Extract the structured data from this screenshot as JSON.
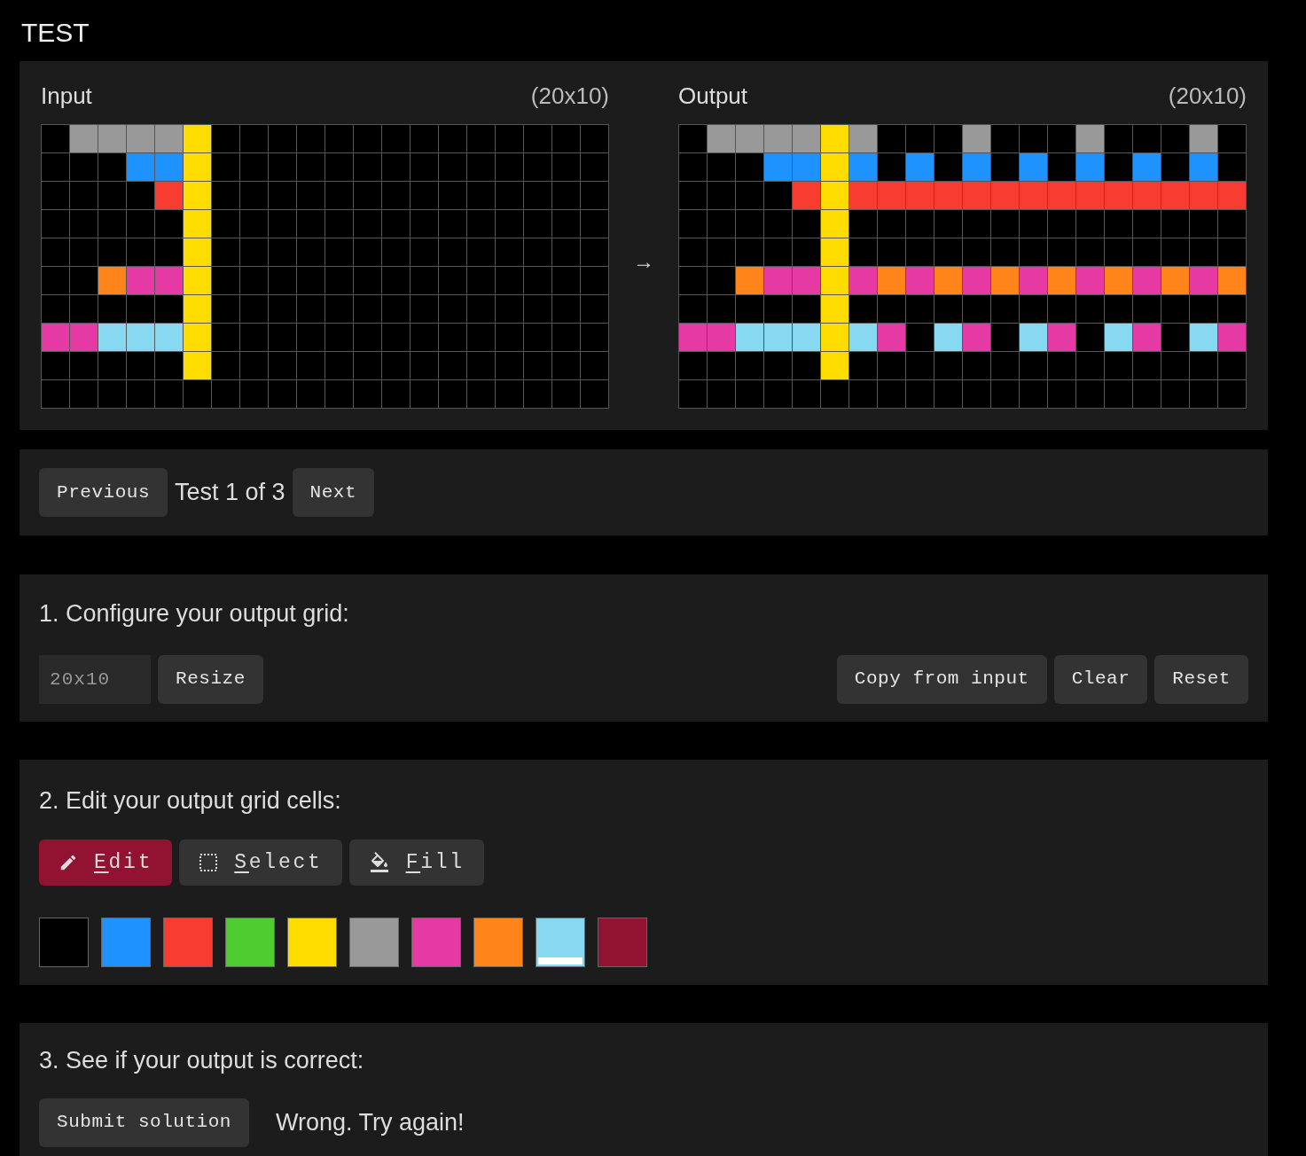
{
  "title": "TEST",
  "pair": {
    "input": {
      "label": "Input",
      "size": "(20x10)",
      "rows": [
        {
          "cells": [
            {
              "color": "#000000"
            },
            {
              "color": "#999999"
            },
            {
              "color": "#999999"
            },
            {
              "color": "#999999"
            },
            {
              "color": "#999999"
            },
            {
              "color": "#ffdc00"
            },
            {
              "color": "#000000"
            },
            {
              "color": "#000000"
            },
            {
              "color": "#000000"
            },
            {
              "color": "#000000"
            },
            {
              "color": "#000000"
            },
            {
              "color": "#000000"
            },
            {
              "color": "#000000"
            },
            {
              "color": "#000000"
            },
            {
              "color": "#000000"
            },
            {
              "color": "#000000"
            },
            {
              "color": "#000000"
            },
            {
              "color": "#000000"
            },
            {
              "color": "#000000"
            },
            {
              "color": "#000000"
            }
          ]
        },
        {
          "cells": [
            {
              "color": "#000000"
            },
            {
              "color": "#000000"
            },
            {
              "color": "#000000"
            },
            {
              "color": "#1e93ff"
            },
            {
              "color": "#1e93ff"
            },
            {
              "color": "#ffdc00"
            },
            {
              "color": "#000000"
            },
            {
              "color": "#000000"
            },
            {
              "color": "#000000"
            },
            {
              "color": "#000000"
            },
            {
              "color": "#000000"
            },
            {
              "color": "#000000"
            },
            {
              "color": "#000000"
            },
            {
              "color": "#000000"
            },
            {
              "color": "#000000"
            },
            {
              "color": "#000000"
            },
            {
              "color": "#000000"
            },
            {
              "color": "#000000"
            },
            {
              "color": "#000000"
            },
            {
              "color": "#000000"
            }
          ]
        },
        {
          "cells": [
            {
              "color": "#000000"
            },
            {
              "color": "#000000"
            },
            {
              "color": "#000000"
            },
            {
              "color": "#000000"
            },
            {
              "color": "#f93c31"
            },
            {
              "color": "#ffdc00"
            },
            {
              "color": "#000000"
            },
            {
              "color": "#000000"
            },
            {
              "color": "#000000"
            },
            {
              "color": "#000000"
            },
            {
              "color": "#000000"
            },
            {
              "color": "#000000"
            },
            {
              "color": "#000000"
            },
            {
              "color": "#000000"
            },
            {
              "color": "#000000"
            },
            {
              "color": "#000000"
            },
            {
              "color": "#000000"
            },
            {
              "color": "#000000"
            },
            {
              "color": "#000000"
            },
            {
              "color": "#000000"
            }
          ]
        },
        {
          "cells": [
            {
              "color": "#000000"
            },
            {
              "color": "#000000"
            },
            {
              "color": "#000000"
            },
            {
              "color": "#000000"
            },
            {
              "color": "#000000"
            },
            {
              "color": "#ffdc00"
            },
            {
              "color": "#000000"
            },
            {
              "color": "#000000"
            },
            {
              "color": "#000000"
            },
            {
              "color": "#000000"
            },
            {
              "color": "#000000"
            },
            {
              "color": "#000000"
            },
            {
              "color": "#000000"
            },
            {
              "color": "#000000"
            },
            {
              "color": "#000000"
            },
            {
              "color": "#000000"
            },
            {
              "color": "#000000"
            },
            {
              "color": "#000000"
            },
            {
              "color": "#000000"
            },
            {
              "color": "#000000"
            }
          ]
        },
        {
          "cells": [
            {
              "color": "#000000"
            },
            {
              "color": "#000000"
            },
            {
              "color": "#000000"
            },
            {
              "color": "#000000"
            },
            {
              "color": "#000000"
            },
            {
              "color": "#ffdc00"
            },
            {
              "color": "#000000"
            },
            {
              "color": "#000000"
            },
            {
              "color": "#000000"
            },
            {
              "color": "#000000"
            },
            {
              "color": "#000000"
            },
            {
              "color": "#000000"
            },
            {
              "color": "#000000"
            },
            {
              "color": "#000000"
            },
            {
              "color": "#000000"
            },
            {
              "color": "#000000"
            },
            {
              "color": "#000000"
            },
            {
              "color": "#000000"
            },
            {
              "color": "#000000"
            },
            {
              "color": "#000000"
            }
          ]
        },
        {
          "cells": [
            {
              "color": "#000000"
            },
            {
              "color": "#000000"
            },
            {
              "color": "#ff851b"
            },
            {
              "color": "#e53aa3"
            },
            {
              "color": "#e53aa3"
            },
            {
              "color": "#ffdc00"
            },
            {
              "color": "#000000"
            },
            {
              "color": "#000000"
            },
            {
              "color": "#000000"
            },
            {
              "color": "#000000"
            },
            {
              "color": "#000000"
            },
            {
              "color": "#000000"
            },
            {
              "color": "#000000"
            },
            {
              "color": "#000000"
            },
            {
              "color": "#000000"
            },
            {
              "color": "#000000"
            },
            {
              "color": "#000000"
            },
            {
              "color": "#000000"
            },
            {
              "color": "#000000"
            },
            {
              "color": "#000000"
            }
          ]
        },
        {
          "cells": [
            {
              "color": "#000000"
            },
            {
              "color": "#000000"
            },
            {
              "color": "#000000"
            },
            {
              "color": "#000000"
            },
            {
              "color": "#000000"
            },
            {
              "color": "#ffdc00"
            },
            {
              "color": "#000000"
            },
            {
              "color": "#000000"
            },
            {
              "color": "#000000"
            },
            {
              "color": "#000000"
            },
            {
              "color": "#000000"
            },
            {
              "color": "#000000"
            },
            {
              "color": "#000000"
            },
            {
              "color": "#000000"
            },
            {
              "color": "#000000"
            },
            {
              "color": "#000000"
            },
            {
              "color": "#000000"
            },
            {
              "color": "#000000"
            },
            {
              "color": "#000000"
            },
            {
              "color": "#000000"
            }
          ]
        },
        {
          "cells": [
            {
              "color": "#e53aa3"
            },
            {
              "color": "#e53aa3"
            },
            {
              "color": "#87d8f1"
            },
            {
              "color": "#87d8f1"
            },
            {
              "color": "#87d8f1"
            },
            {
              "color": "#ffdc00"
            },
            {
              "color": "#000000"
            },
            {
              "color": "#000000"
            },
            {
              "color": "#000000"
            },
            {
              "color": "#000000"
            },
            {
              "color": "#000000"
            },
            {
              "color": "#000000"
            },
            {
              "color": "#000000"
            },
            {
              "color": "#000000"
            },
            {
              "color": "#000000"
            },
            {
              "color": "#000000"
            },
            {
              "color": "#000000"
            },
            {
              "color": "#000000"
            },
            {
              "color": "#000000"
            },
            {
              "color": "#000000"
            }
          ]
        },
        {
          "cells": [
            {
              "color": "#000000"
            },
            {
              "color": "#000000"
            },
            {
              "color": "#000000"
            },
            {
              "color": "#000000"
            },
            {
              "color": "#000000"
            },
            {
              "color": "#ffdc00"
            },
            {
              "color": "#000000"
            },
            {
              "color": "#000000"
            },
            {
              "color": "#000000"
            },
            {
              "color": "#000000"
            },
            {
              "color": "#000000"
            },
            {
              "color": "#000000"
            },
            {
              "color": "#000000"
            },
            {
              "color": "#000000"
            },
            {
              "color": "#000000"
            },
            {
              "color": "#000000"
            },
            {
              "color": "#000000"
            },
            {
              "color": "#000000"
            },
            {
              "color": "#000000"
            },
            {
              "color": "#000000"
            }
          ]
        },
        {
          "cells": [
            {
              "color": "#000000"
            },
            {
              "color": "#000000"
            },
            {
              "color": "#000000"
            },
            {
              "color": "#000000"
            },
            {
              "color": "#000000"
            },
            {
              "color": "#000000"
            },
            {
              "color": "#000000"
            },
            {
              "color": "#000000"
            },
            {
              "color": "#000000"
            },
            {
              "color": "#000000"
            },
            {
              "color": "#000000"
            },
            {
              "color": "#000000"
            },
            {
              "color": "#000000"
            },
            {
              "color": "#000000"
            },
            {
              "color": "#000000"
            },
            {
              "color": "#000000"
            },
            {
              "color": "#000000"
            },
            {
              "color": "#000000"
            },
            {
              "color": "#000000"
            },
            {
              "color": "#000000"
            }
          ]
        }
      ]
    },
    "arrow": "→",
    "output": {
      "label": "Output",
      "size": "(20x10)",
      "rows": [
        {
          "cells": [
            {
              "color": "#000000"
            },
            {
              "color": "#999999"
            },
            {
              "color": "#999999"
            },
            {
              "color": "#999999"
            },
            {
              "color": "#999999"
            },
            {
              "color": "#ffdc00"
            },
            {
              "color": "#999999"
            },
            {
              "color": "#000000"
            },
            {
              "color": "#000000"
            },
            {
              "color": "#000000"
            },
            {
              "color": "#999999"
            },
            {
              "color": "#000000"
            },
            {
              "color": "#000000"
            },
            {
              "color": "#000000"
            },
            {
              "color": "#999999"
            },
            {
              "color": "#000000"
            },
            {
              "color": "#000000"
            },
            {
              "color": "#000000"
            },
            {
              "color": "#999999"
            },
            {
              "color": "#000000"
            }
          ]
        },
        {
          "cells": [
            {
              "color": "#000000"
            },
            {
              "color": "#000000"
            },
            {
              "color": "#000000"
            },
            {
              "color": "#1e93ff"
            },
            {
              "color": "#1e93ff"
            },
            {
              "color": "#ffdc00"
            },
            {
              "color": "#1e93ff"
            },
            {
              "color": "#000000"
            },
            {
              "color": "#1e93ff"
            },
            {
              "color": "#000000"
            },
            {
              "color": "#1e93ff"
            },
            {
              "color": "#000000"
            },
            {
              "color": "#1e93ff"
            },
            {
              "color": "#000000"
            },
            {
              "color": "#1e93ff"
            },
            {
              "color": "#000000"
            },
            {
              "color": "#1e93ff"
            },
            {
              "color": "#000000"
            },
            {
              "color": "#1e93ff"
            },
            {
              "color": "#000000"
            }
          ]
        },
        {
          "cells": [
            {
              "color": "#000000"
            },
            {
              "color": "#000000"
            },
            {
              "color": "#000000"
            },
            {
              "color": "#000000"
            },
            {
              "color": "#f93c31"
            },
            {
              "color": "#ffdc00"
            },
            {
              "color": "#f93c31"
            },
            {
              "color": "#f93c31"
            },
            {
              "color": "#f93c31"
            },
            {
              "color": "#f93c31"
            },
            {
              "color": "#f93c31"
            },
            {
              "color": "#f93c31"
            },
            {
              "color": "#f93c31"
            },
            {
              "color": "#f93c31"
            },
            {
              "color": "#f93c31"
            },
            {
              "color": "#f93c31"
            },
            {
              "color": "#f93c31"
            },
            {
              "color": "#f93c31"
            },
            {
              "color": "#f93c31"
            },
            {
              "color": "#f93c31"
            }
          ]
        },
        {
          "cells": [
            {
              "color": "#000000"
            },
            {
              "color": "#000000"
            },
            {
              "color": "#000000"
            },
            {
              "color": "#000000"
            },
            {
              "color": "#000000"
            },
            {
              "color": "#ffdc00"
            },
            {
              "color": "#000000"
            },
            {
              "color": "#000000"
            },
            {
              "color": "#000000"
            },
            {
              "color": "#000000"
            },
            {
              "color": "#000000"
            },
            {
              "color": "#000000"
            },
            {
              "color": "#000000"
            },
            {
              "color": "#000000"
            },
            {
              "color": "#000000"
            },
            {
              "color": "#000000"
            },
            {
              "color": "#000000"
            },
            {
              "color": "#000000"
            },
            {
              "color": "#000000"
            },
            {
              "color": "#000000"
            }
          ]
        },
        {
          "cells": [
            {
              "color": "#000000"
            },
            {
              "color": "#000000"
            },
            {
              "color": "#000000"
            },
            {
              "color": "#000000"
            },
            {
              "color": "#000000"
            },
            {
              "color": "#ffdc00"
            },
            {
              "color": "#000000"
            },
            {
              "color": "#000000"
            },
            {
              "color": "#000000"
            },
            {
              "color": "#000000"
            },
            {
              "color": "#000000"
            },
            {
              "color": "#000000"
            },
            {
              "color": "#000000"
            },
            {
              "color": "#000000"
            },
            {
              "color": "#000000"
            },
            {
              "color": "#000000"
            },
            {
              "color": "#000000"
            },
            {
              "color": "#000000"
            },
            {
              "color": "#000000"
            },
            {
              "color": "#000000"
            }
          ]
        },
        {
          "cells": [
            {
              "color": "#000000"
            },
            {
              "color": "#000000"
            },
            {
              "color": "#ff851b"
            },
            {
              "color": "#e53aa3"
            },
            {
              "color": "#e53aa3"
            },
            {
              "color": "#ffdc00"
            },
            {
              "color": "#e53aa3"
            },
            {
              "color": "#ff851b"
            },
            {
              "color": "#e53aa3"
            },
            {
              "color": "#ff851b"
            },
            {
              "color": "#e53aa3"
            },
            {
              "color": "#ff851b"
            },
            {
              "color": "#e53aa3"
            },
            {
              "color": "#ff851b"
            },
            {
              "color": "#e53aa3"
            },
            {
              "color": "#ff851b"
            },
            {
              "color": "#e53aa3"
            },
            {
              "color": "#ff851b"
            },
            {
              "color": "#e53aa3"
            },
            {
              "color": "#ff851b"
            }
          ]
        },
        {
          "cells": [
            {
              "color": "#000000"
            },
            {
              "color": "#000000"
            },
            {
              "color": "#000000"
            },
            {
              "color": "#000000"
            },
            {
              "color": "#000000"
            },
            {
              "color": "#ffdc00"
            },
            {
              "color": "#000000"
            },
            {
              "color": "#000000"
            },
            {
              "color": "#000000"
            },
            {
              "color": "#000000"
            },
            {
              "color": "#000000"
            },
            {
              "color": "#000000"
            },
            {
              "color": "#000000"
            },
            {
              "color": "#000000"
            },
            {
              "color": "#000000"
            },
            {
              "color": "#000000"
            },
            {
              "color": "#000000"
            },
            {
              "color": "#000000"
            },
            {
              "color": "#000000"
            },
            {
              "color": "#000000"
            }
          ]
        },
        {
          "cells": [
            {
              "color": "#e53aa3"
            },
            {
              "color": "#e53aa3"
            },
            {
              "color": "#87d8f1"
            },
            {
              "color": "#87d8f1"
            },
            {
              "color": "#87d8f1"
            },
            {
              "color": "#ffdc00"
            },
            {
              "color": "#87d8f1"
            },
            {
              "color": "#e53aa3"
            },
            {
              "color": "#000000"
            },
            {
              "color": "#87d8f1"
            },
            {
              "color": "#e53aa3"
            },
            {
              "color": "#000000"
            },
            {
              "color": "#87d8f1"
            },
            {
              "color": "#e53aa3"
            },
            {
              "color": "#000000"
            },
            {
              "color": "#87d8f1"
            },
            {
              "color": "#e53aa3"
            },
            {
              "color": "#000000"
            },
            {
              "color": "#87d8f1"
            },
            {
              "color": "#e53aa3"
            }
          ]
        },
        {
          "cells": [
            {
              "color": "#000000"
            },
            {
              "color": "#000000"
            },
            {
              "color": "#000000"
            },
            {
              "color": "#000000"
            },
            {
              "color": "#000000"
            },
            {
              "color": "#ffdc00"
            },
            {
              "color": "#000000"
            },
            {
              "color": "#000000"
            },
            {
              "color": "#000000"
            },
            {
              "color": "#000000"
            },
            {
              "color": "#000000"
            },
            {
              "color": "#000000"
            },
            {
              "color": "#000000"
            },
            {
              "color": "#000000"
            },
            {
              "color": "#000000"
            },
            {
              "color": "#000000"
            },
            {
              "color": "#000000"
            },
            {
              "color": "#000000"
            },
            {
              "color": "#000000"
            },
            {
              "color": "#000000"
            }
          ]
        },
        {
          "cells": [
            {
              "color": "#000000"
            },
            {
              "color": "#000000"
            },
            {
              "color": "#000000"
            },
            {
              "color": "#000000"
            },
            {
              "color": "#000000"
            },
            {
              "color": "#000000"
            },
            {
              "color": "#000000"
            },
            {
              "color": "#000000"
            },
            {
              "color": "#000000"
            },
            {
              "color": "#000000"
            },
            {
              "color": "#000000"
            },
            {
              "color": "#000000"
            },
            {
              "color": "#000000"
            },
            {
              "color": "#000000"
            },
            {
              "color": "#000000"
            },
            {
              "color": "#000000"
            },
            {
              "color": "#000000"
            },
            {
              "color": "#000000"
            },
            {
              "color": "#000000"
            },
            {
              "color": "#000000"
            }
          ]
        }
      ]
    }
  },
  "nav": {
    "previous": "Previous",
    "status": "Test 1 of 3",
    "next": "Next"
  },
  "configure": {
    "heading": "1. Configure your output grid:",
    "size_field": {
      "value": "20x10"
    },
    "resize": "Resize",
    "actions": [
      "Copy from input",
      "Clear",
      "Reset"
    ]
  },
  "edit": {
    "heading": "2. Edit your output grid cells:",
    "modes": [
      {
        "kind": "edit",
        "label": "Edit",
        "selected": true
      },
      {
        "kind": "select",
        "label": "Select",
        "selected": false
      },
      {
        "kind": "fill",
        "label": "Fill",
        "selected": false
      }
    ],
    "palette": [
      {
        "color": "#000000",
        "selected": false
      },
      {
        "color": "#1e93ff",
        "selected": false
      },
      {
        "color": "#f93c31",
        "selected": false
      },
      {
        "color": "#4fcc30",
        "selected": false
      },
      {
        "color": "#ffdc00",
        "selected": false
      },
      {
        "color": "#999999",
        "selected": false
      },
      {
        "color": "#e53aa3",
        "selected": false
      },
      {
        "color": "#ff851b",
        "selected": false
      },
      {
        "color": "#87d8f1",
        "selected": true
      },
      {
        "color": "#921231",
        "selected": false
      }
    ]
  },
  "submit": {
    "heading": "3. See if your output is correct:",
    "button": "Submit solution",
    "message": "Wrong. Try again!"
  }
}
